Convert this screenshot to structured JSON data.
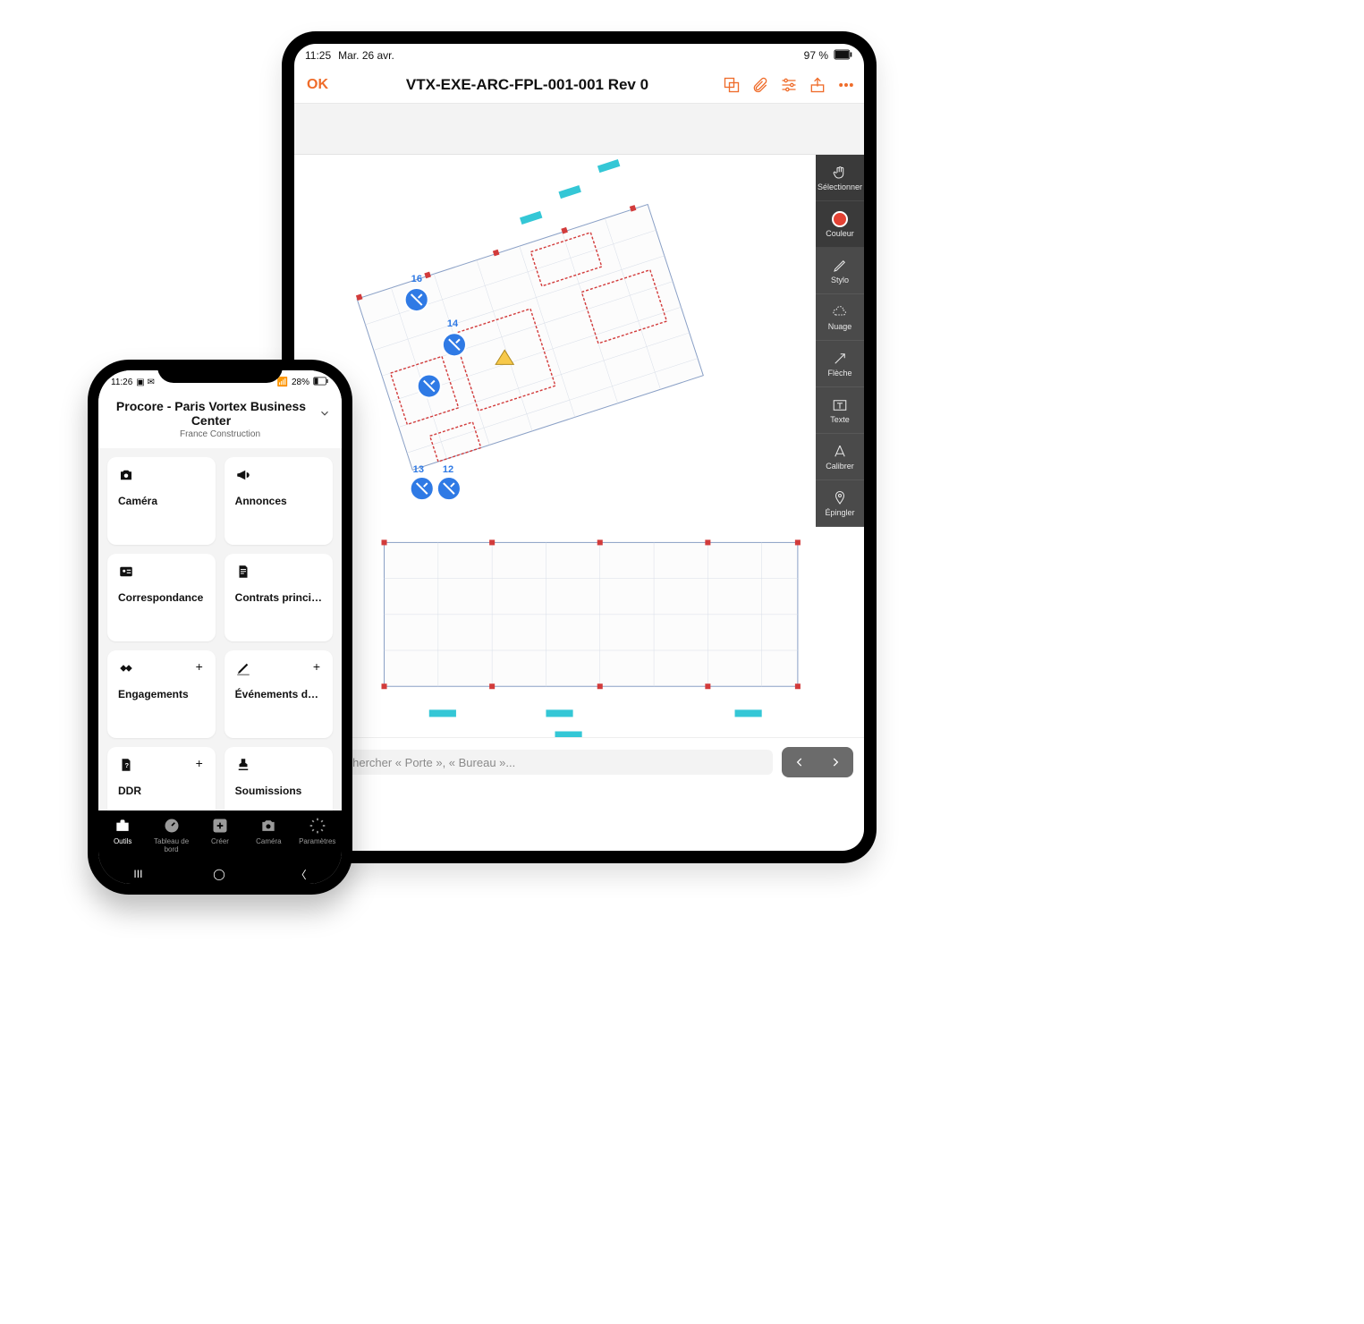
{
  "tablet": {
    "status": {
      "time": "11:25",
      "date": "Mar. 26 avr.",
      "battery": "97 %"
    },
    "header": {
      "ok": "OK",
      "title": "VTX-EXE-ARC-FPL-001-001 Rev 0"
    },
    "tools": [
      {
        "key": "select",
        "label": "Sélectionner"
      },
      {
        "key": "color",
        "label": "Couleur"
      },
      {
        "key": "pen",
        "label": "Stylo"
      },
      {
        "key": "cloud",
        "label": "Nuage"
      },
      {
        "key": "arrow",
        "label": "Flèche"
      },
      {
        "key": "text",
        "label": "Texte"
      },
      {
        "key": "calibrate",
        "label": "Calibrer"
      },
      {
        "key": "pin",
        "label": "Épingler"
      }
    ],
    "pins": [
      12,
      13,
      14,
      16
    ],
    "search_placeholder": "Rechercher « Porte », « Bureau »..."
  },
  "phone": {
    "status": {
      "time": "11:26",
      "battery": "28%"
    },
    "app": "Procore",
    "project": "Paris Vortex Business Center",
    "company": "France Construction",
    "cards": [
      {
        "icon": "camera",
        "label": "Caméra",
        "plus": false
      },
      {
        "icon": "announce",
        "label": "Annonces",
        "plus": false
      },
      {
        "icon": "corresp",
        "label": "Correspondance",
        "plus": false
      },
      {
        "icon": "contract",
        "label": "Contrats princi…",
        "plus": false
      },
      {
        "icon": "engage",
        "label": "Engagements",
        "plus": true
      },
      {
        "icon": "events",
        "label": "Événements d…",
        "plus": true
      },
      {
        "icon": "ddr",
        "label": "DDR",
        "plus": true
      },
      {
        "icon": "submit",
        "label": "Soumissions",
        "plus": false
      }
    ],
    "tabs": [
      {
        "key": "tools",
        "label": "Outils",
        "active": true
      },
      {
        "key": "dash",
        "label": "Tableau de\nbord",
        "active": false
      },
      {
        "key": "create",
        "label": "Créer",
        "active": false
      },
      {
        "key": "camera",
        "label": "Caméra",
        "active": false
      },
      {
        "key": "settings",
        "label": "Paramètres",
        "active": false
      }
    ]
  }
}
